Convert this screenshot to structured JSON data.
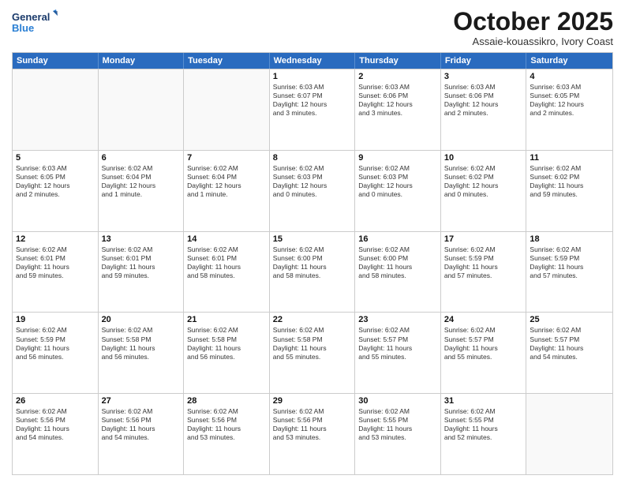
{
  "logo": {
    "line1": "General",
    "line2": "Blue"
  },
  "title": "October 2025",
  "subtitle": "Assaie-kouassikro, Ivory Coast",
  "header_days": [
    "Sunday",
    "Monday",
    "Tuesday",
    "Wednesday",
    "Thursday",
    "Friday",
    "Saturday"
  ],
  "rows": [
    [
      {
        "day": "",
        "text": ""
      },
      {
        "day": "",
        "text": ""
      },
      {
        "day": "",
        "text": ""
      },
      {
        "day": "1",
        "text": "Sunrise: 6:03 AM\nSunset: 6:07 PM\nDaylight: 12 hours\nand 3 minutes."
      },
      {
        "day": "2",
        "text": "Sunrise: 6:03 AM\nSunset: 6:06 PM\nDaylight: 12 hours\nand 3 minutes."
      },
      {
        "day": "3",
        "text": "Sunrise: 6:03 AM\nSunset: 6:06 PM\nDaylight: 12 hours\nand 2 minutes."
      },
      {
        "day": "4",
        "text": "Sunrise: 6:03 AM\nSunset: 6:05 PM\nDaylight: 12 hours\nand 2 minutes."
      }
    ],
    [
      {
        "day": "5",
        "text": "Sunrise: 6:03 AM\nSunset: 6:05 PM\nDaylight: 12 hours\nand 2 minutes."
      },
      {
        "day": "6",
        "text": "Sunrise: 6:02 AM\nSunset: 6:04 PM\nDaylight: 12 hours\nand 1 minute."
      },
      {
        "day": "7",
        "text": "Sunrise: 6:02 AM\nSunset: 6:04 PM\nDaylight: 12 hours\nand 1 minute."
      },
      {
        "day": "8",
        "text": "Sunrise: 6:02 AM\nSunset: 6:03 PM\nDaylight: 12 hours\nand 0 minutes."
      },
      {
        "day": "9",
        "text": "Sunrise: 6:02 AM\nSunset: 6:03 PM\nDaylight: 12 hours\nand 0 minutes."
      },
      {
        "day": "10",
        "text": "Sunrise: 6:02 AM\nSunset: 6:02 PM\nDaylight: 12 hours\nand 0 minutes."
      },
      {
        "day": "11",
        "text": "Sunrise: 6:02 AM\nSunset: 6:02 PM\nDaylight: 11 hours\nand 59 minutes."
      }
    ],
    [
      {
        "day": "12",
        "text": "Sunrise: 6:02 AM\nSunset: 6:01 PM\nDaylight: 11 hours\nand 59 minutes."
      },
      {
        "day": "13",
        "text": "Sunrise: 6:02 AM\nSunset: 6:01 PM\nDaylight: 11 hours\nand 59 minutes."
      },
      {
        "day": "14",
        "text": "Sunrise: 6:02 AM\nSunset: 6:01 PM\nDaylight: 11 hours\nand 58 minutes."
      },
      {
        "day": "15",
        "text": "Sunrise: 6:02 AM\nSunset: 6:00 PM\nDaylight: 11 hours\nand 58 minutes."
      },
      {
        "day": "16",
        "text": "Sunrise: 6:02 AM\nSunset: 6:00 PM\nDaylight: 11 hours\nand 58 minutes."
      },
      {
        "day": "17",
        "text": "Sunrise: 6:02 AM\nSunset: 5:59 PM\nDaylight: 11 hours\nand 57 minutes."
      },
      {
        "day": "18",
        "text": "Sunrise: 6:02 AM\nSunset: 5:59 PM\nDaylight: 11 hours\nand 57 minutes."
      }
    ],
    [
      {
        "day": "19",
        "text": "Sunrise: 6:02 AM\nSunset: 5:59 PM\nDaylight: 11 hours\nand 56 minutes."
      },
      {
        "day": "20",
        "text": "Sunrise: 6:02 AM\nSunset: 5:58 PM\nDaylight: 11 hours\nand 56 minutes."
      },
      {
        "day": "21",
        "text": "Sunrise: 6:02 AM\nSunset: 5:58 PM\nDaylight: 11 hours\nand 56 minutes."
      },
      {
        "day": "22",
        "text": "Sunrise: 6:02 AM\nSunset: 5:58 PM\nDaylight: 11 hours\nand 55 minutes."
      },
      {
        "day": "23",
        "text": "Sunrise: 6:02 AM\nSunset: 5:57 PM\nDaylight: 11 hours\nand 55 minutes."
      },
      {
        "day": "24",
        "text": "Sunrise: 6:02 AM\nSunset: 5:57 PM\nDaylight: 11 hours\nand 55 minutes."
      },
      {
        "day": "25",
        "text": "Sunrise: 6:02 AM\nSunset: 5:57 PM\nDaylight: 11 hours\nand 54 minutes."
      }
    ],
    [
      {
        "day": "26",
        "text": "Sunrise: 6:02 AM\nSunset: 5:56 PM\nDaylight: 11 hours\nand 54 minutes."
      },
      {
        "day": "27",
        "text": "Sunrise: 6:02 AM\nSunset: 5:56 PM\nDaylight: 11 hours\nand 54 minutes."
      },
      {
        "day": "28",
        "text": "Sunrise: 6:02 AM\nSunset: 5:56 PM\nDaylight: 11 hours\nand 53 minutes."
      },
      {
        "day": "29",
        "text": "Sunrise: 6:02 AM\nSunset: 5:56 PM\nDaylight: 11 hours\nand 53 minutes."
      },
      {
        "day": "30",
        "text": "Sunrise: 6:02 AM\nSunset: 5:55 PM\nDaylight: 11 hours\nand 53 minutes."
      },
      {
        "day": "31",
        "text": "Sunrise: 6:02 AM\nSunset: 5:55 PM\nDaylight: 11 hours\nand 52 minutes."
      },
      {
        "day": "",
        "text": ""
      }
    ]
  ]
}
